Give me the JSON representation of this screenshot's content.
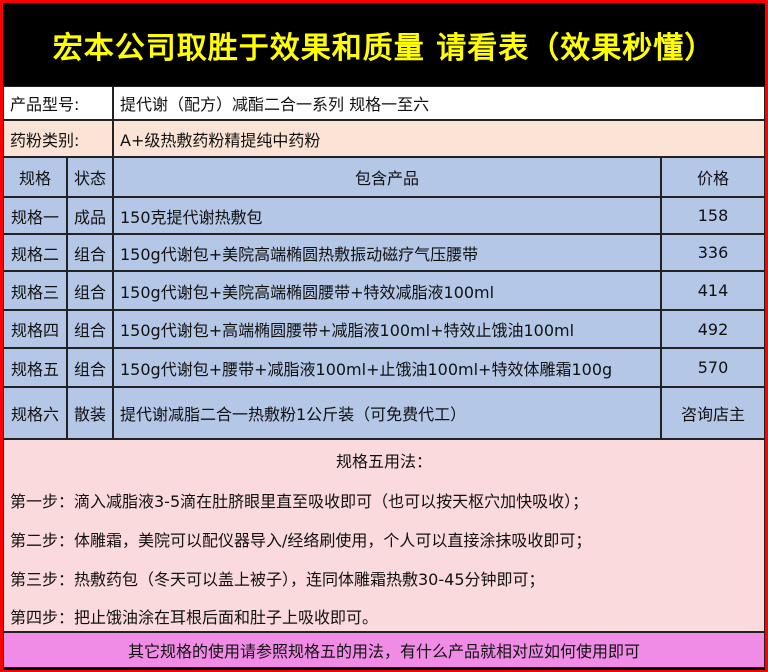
{
  "title": "宏本公司取胜于效果和质量 请看表（效果秒懂）",
  "info": {
    "product_model_label": "产品型号:",
    "product_model_value": "提代谢（配方）减酯二合一系列 规格一至六",
    "category_label": "药粉类别:",
    "category_value": "A+级热敷药粉精提纯中药粉"
  },
  "table": {
    "headers": [
      "规格",
      "状态",
      "包含产品",
      "价格"
    ],
    "rows": [
      {
        "spec": "规格一",
        "status": "成品",
        "product": "150克提代谢热敷包",
        "price": "158"
      },
      {
        "spec": "规格二",
        "status": "组合",
        "product": "150g代谢包+美院高端椭圆热敷振动磁疗气压腰带",
        "price": "336"
      },
      {
        "spec": "规格三",
        "status": "组合",
        "product": "150g代谢包+美院高端椭圆腰带+特效减脂液100ml",
        "price": "414"
      },
      {
        "spec": "规格四",
        "status": "组合",
        "product": "150g代谢包+高端椭圆腰带+减脂液100ml+特效止饿油100ml",
        "price": "492"
      },
      {
        "spec": "规格五",
        "status": "组合",
        "product": "150g代谢包+腰带+减脂液100ml+止饿油100ml+特效体雕霜100g",
        "price": "570"
      },
      {
        "spec": "规格六",
        "status": "散装",
        "product": "提代谢减脂二合一热敷粉1公斤装（可免费代工）",
        "price": "咨询店主"
      }
    ]
  },
  "usage": {
    "title": "规格五用法：",
    "steps": [
      "第一步：滴入减脂液3-5滴在肚脐眼里直至吸收即可（也可以按天枢穴加快吸收）；",
      "第二步：体雕霜，美院可以配仪器导入/经络刷使用，个人可以直接涂抹吸收即可；",
      "第三步：热敷药包（冬天可以盖上被子），连同体雕霜热敷30-45分钟即可；",
      "第四步：把止饿油涂在耳根后面和肚子上吸收即可。"
    ]
  },
  "footer": "其它规格的使用请参照规格五的用法，有什么产品就相对应如何使用即可",
  "colors": {
    "frame": "#ff0000",
    "title_bg": "#000000",
    "title_text": "#ffff00",
    "info_row_1": "#ffffff",
    "info_row_2": "#fbe4d5",
    "table_bg": "#b4c7e7",
    "usage_bg": "#fadadd",
    "footer_bg": "#f08ce6"
  }
}
